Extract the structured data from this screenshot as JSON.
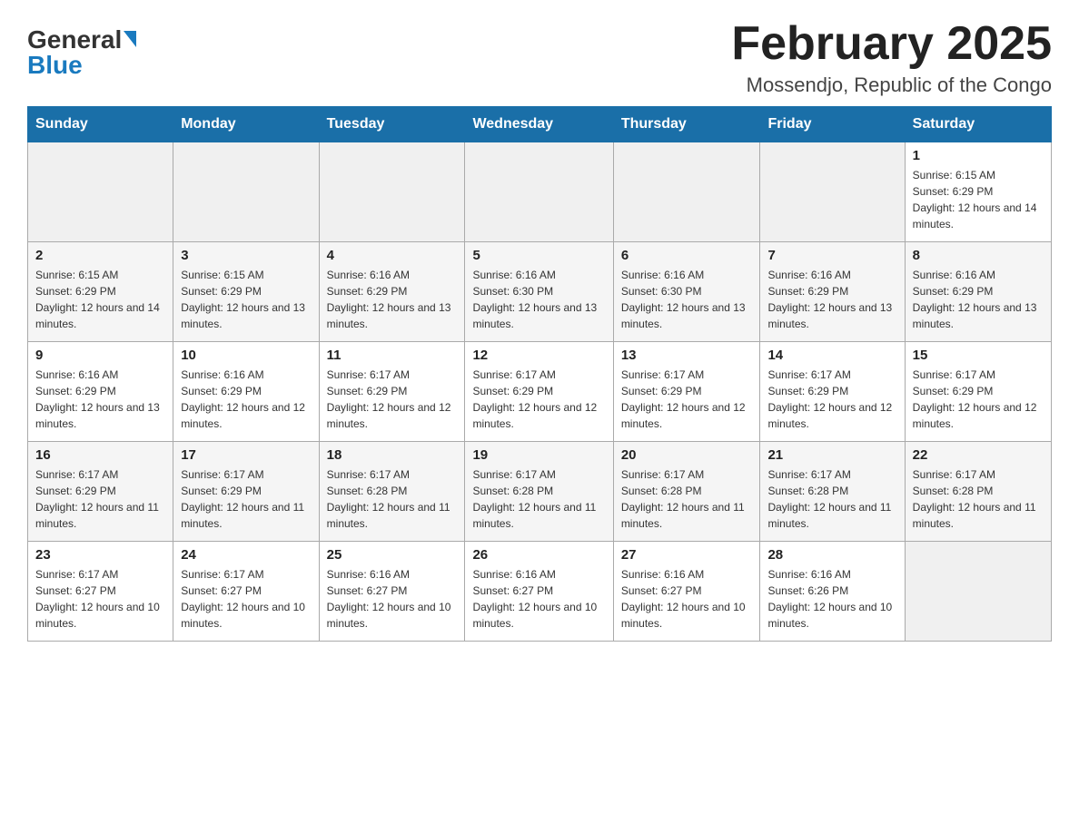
{
  "header": {
    "logo_general": "General",
    "logo_blue": "Blue",
    "month_title": "February 2025",
    "location": "Mossendjo, Republic of the Congo"
  },
  "days_of_week": [
    "Sunday",
    "Monday",
    "Tuesday",
    "Wednesday",
    "Thursday",
    "Friday",
    "Saturday"
  ],
  "weeks": [
    [
      {
        "day": "",
        "info": ""
      },
      {
        "day": "",
        "info": ""
      },
      {
        "day": "",
        "info": ""
      },
      {
        "day": "",
        "info": ""
      },
      {
        "day": "",
        "info": ""
      },
      {
        "day": "",
        "info": ""
      },
      {
        "day": "1",
        "info": "Sunrise: 6:15 AM\nSunset: 6:29 PM\nDaylight: 12 hours and 14 minutes."
      }
    ],
    [
      {
        "day": "2",
        "info": "Sunrise: 6:15 AM\nSunset: 6:29 PM\nDaylight: 12 hours and 14 minutes."
      },
      {
        "day": "3",
        "info": "Sunrise: 6:15 AM\nSunset: 6:29 PM\nDaylight: 12 hours and 13 minutes."
      },
      {
        "day": "4",
        "info": "Sunrise: 6:16 AM\nSunset: 6:29 PM\nDaylight: 12 hours and 13 minutes."
      },
      {
        "day": "5",
        "info": "Sunrise: 6:16 AM\nSunset: 6:30 PM\nDaylight: 12 hours and 13 minutes."
      },
      {
        "day": "6",
        "info": "Sunrise: 6:16 AM\nSunset: 6:30 PM\nDaylight: 12 hours and 13 minutes."
      },
      {
        "day": "7",
        "info": "Sunrise: 6:16 AM\nSunset: 6:29 PM\nDaylight: 12 hours and 13 minutes."
      },
      {
        "day": "8",
        "info": "Sunrise: 6:16 AM\nSunset: 6:29 PM\nDaylight: 12 hours and 13 minutes."
      }
    ],
    [
      {
        "day": "9",
        "info": "Sunrise: 6:16 AM\nSunset: 6:29 PM\nDaylight: 12 hours and 13 minutes."
      },
      {
        "day": "10",
        "info": "Sunrise: 6:16 AM\nSunset: 6:29 PM\nDaylight: 12 hours and 12 minutes."
      },
      {
        "day": "11",
        "info": "Sunrise: 6:17 AM\nSunset: 6:29 PM\nDaylight: 12 hours and 12 minutes."
      },
      {
        "day": "12",
        "info": "Sunrise: 6:17 AM\nSunset: 6:29 PM\nDaylight: 12 hours and 12 minutes."
      },
      {
        "day": "13",
        "info": "Sunrise: 6:17 AM\nSunset: 6:29 PM\nDaylight: 12 hours and 12 minutes."
      },
      {
        "day": "14",
        "info": "Sunrise: 6:17 AM\nSunset: 6:29 PM\nDaylight: 12 hours and 12 minutes."
      },
      {
        "day": "15",
        "info": "Sunrise: 6:17 AM\nSunset: 6:29 PM\nDaylight: 12 hours and 12 minutes."
      }
    ],
    [
      {
        "day": "16",
        "info": "Sunrise: 6:17 AM\nSunset: 6:29 PM\nDaylight: 12 hours and 11 minutes."
      },
      {
        "day": "17",
        "info": "Sunrise: 6:17 AM\nSunset: 6:29 PM\nDaylight: 12 hours and 11 minutes."
      },
      {
        "day": "18",
        "info": "Sunrise: 6:17 AM\nSunset: 6:28 PM\nDaylight: 12 hours and 11 minutes."
      },
      {
        "day": "19",
        "info": "Sunrise: 6:17 AM\nSunset: 6:28 PM\nDaylight: 12 hours and 11 minutes."
      },
      {
        "day": "20",
        "info": "Sunrise: 6:17 AM\nSunset: 6:28 PM\nDaylight: 12 hours and 11 minutes."
      },
      {
        "day": "21",
        "info": "Sunrise: 6:17 AM\nSunset: 6:28 PM\nDaylight: 12 hours and 11 minutes."
      },
      {
        "day": "22",
        "info": "Sunrise: 6:17 AM\nSunset: 6:28 PM\nDaylight: 12 hours and 11 minutes."
      }
    ],
    [
      {
        "day": "23",
        "info": "Sunrise: 6:17 AM\nSunset: 6:27 PM\nDaylight: 12 hours and 10 minutes."
      },
      {
        "day": "24",
        "info": "Sunrise: 6:17 AM\nSunset: 6:27 PM\nDaylight: 12 hours and 10 minutes."
      },
      {
        "day": "25",
        "info": "Sunrise: 6:16 AM\nSunset: 6:27 PM\nDaylight: 12 hours and 10 minutes."
      },
      {
        "day": "26",
        "info": "Sunrise: 6:16 AM\nSunset: 6:27 PM\nDaylight: 12 hours and 10 minutes."
      },
      {
        "day": "27",
        "info": "Sunrise: 6:16 AM\nSunset: 6:27 PM\nDaylight: 12 hours and 10 minutes."
      },
      {
        "day": "28",
        "info": "Sunrise: 6:16 AM\nSunset: 6:26 PM\nDaylight: 12 hours and 10 minutes."
      },
      {
        "day": "",
        "info": ""
      }
    ]
  ]
}
